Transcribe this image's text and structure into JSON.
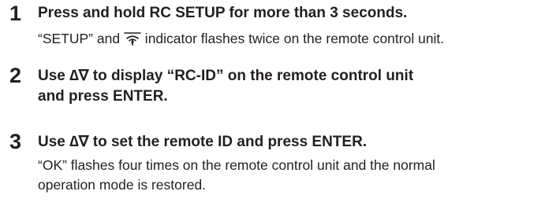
{
  "steps": [
    {
      "number": "1",
      "title": "Press and hold RC SETUP for more than 3 seconds.",
      "description_before_icon": "“SETUP” and ",
      "description_icon": "remote-signal-indicator-icon",
      "description_after_icon": " indicator flashes twice on the remote control unit."
    },
    {
      "number": "2",
      "title_line1": "Use ∆∇ to display “RC-ID” on the remote control unit",
      "title_line2": "and press ENTER."
    },
    {
      "number": "3",
      "title": "Use ∆∇ to set the remote ID and press ENTER.",
      "description_line1": "“OK” flashes four times on the remote control unit and the normal",
      "description_line2": "operation mode is restored."
    }
  ]
}
